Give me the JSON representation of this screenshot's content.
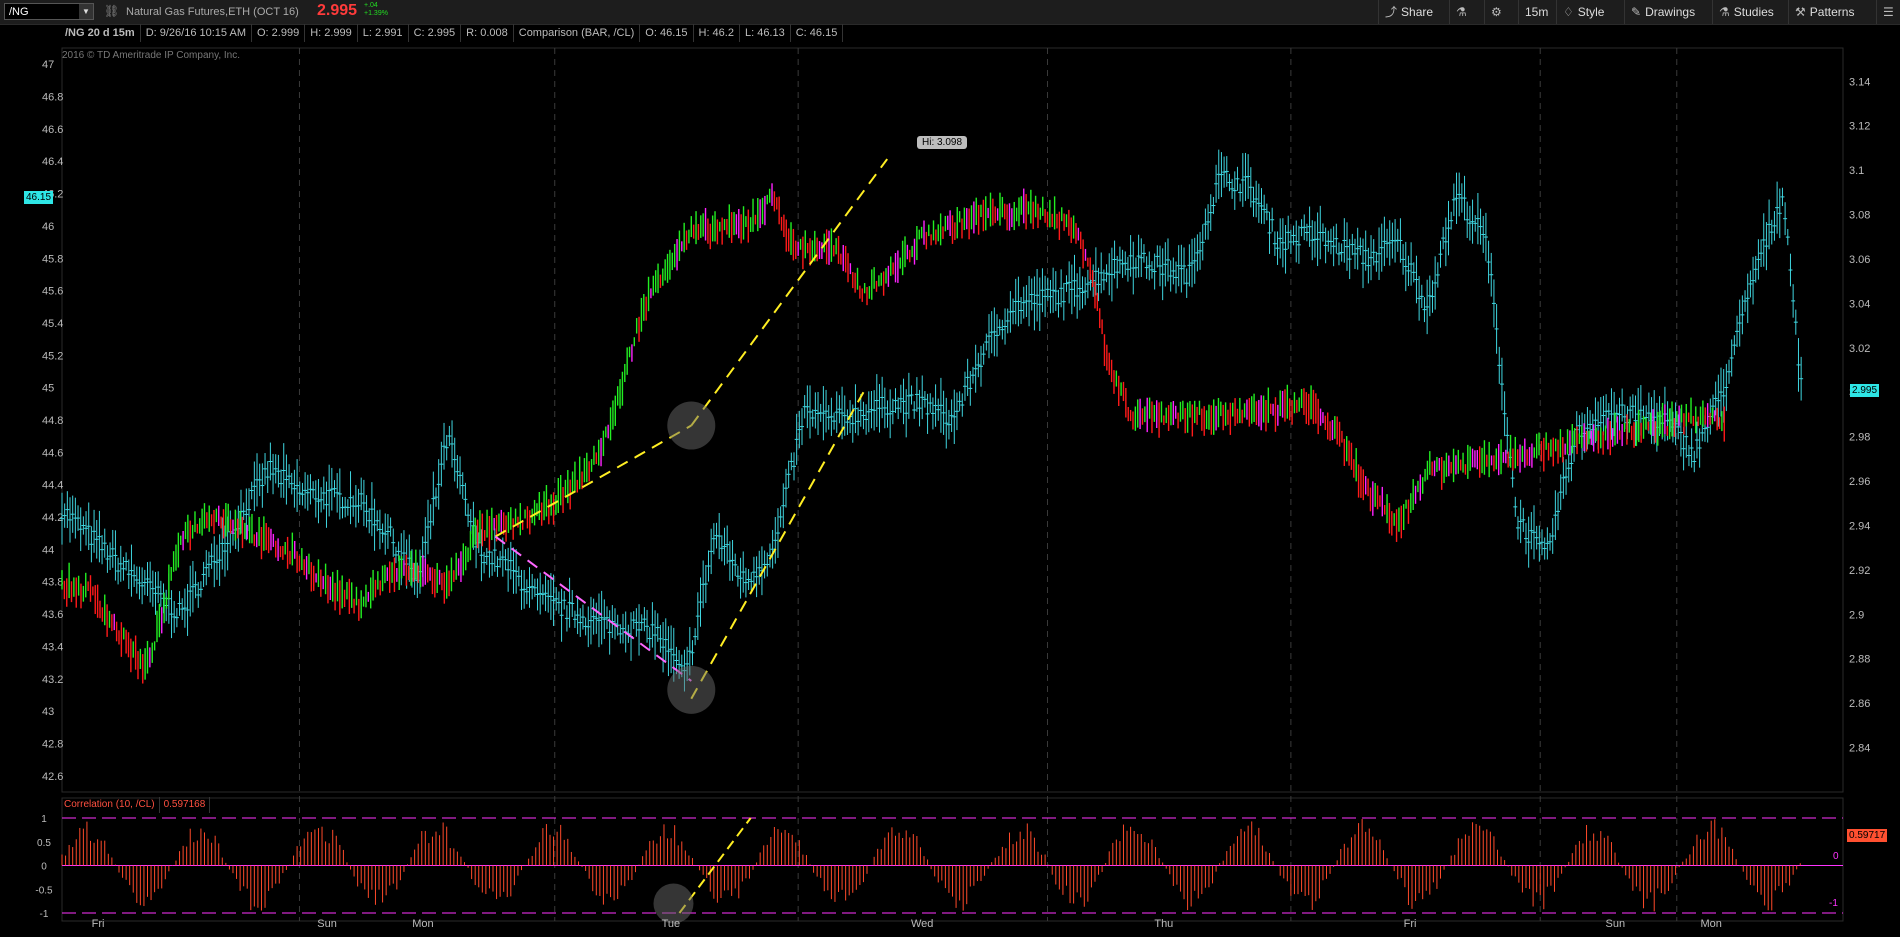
{
  "toolbar": {
    "symbol": "/NG",
    "description": "Natural Gas Futures,ETH (OCT 16)",
    "last_price": "2.995",
    "net_change": "+.04",
    "pct_change": "+1.39%",
    "timeframe": "15m",
    "share_label": "Share",
    "style_label": "Style",
    "drawings_label": "Drawings",
    "studies_label": "Studies",
    "patterns_label": "Patterns"
  },
  "infobar": {
    "symbol_period": "/NG 20 d 15m",
    "date": "D: 9/26/16 10:15 AM",
    "open": "O: 2.999",
    "high": "H: 2.999",
    "low": "L: 2.991",
    "close": "C: 2.995",
    "range": "R: 0.008",
    "comparison": "Comparison (BAR, /CL)",
    "cmp_open": "O: 46.15",
    "cmp_high": "H: 46.2",
    "cmp_low": "L: 46.13",
    "cmp_close": "C: 46.15"
  },
  "copyright": "2016 © TD Ameritrade IP Company, Inc.",
  "correlation": {
    "label": "Correlation (10, /CL)",
    "value": "0.597168",
    "badge": "0.59717",
    "right_zero": "0",
    "right_minus": "-1"
  },
  "hi_label": "Hi: 3.098",
  "left_badge": "46.15",
  "right_badge": "2.995",
  "colors": {
    "up": "#22ee22",
    "down": "#ff1a1a",
    "neutral": "#ff22ff",
    "comparison": "#3fd6e0",
    "trend": "#ffee22",
    "trend_down": "#ff66ff",
    "hist": "#ff4a2a"
  },
  "chart_data": {
    "type": "line",
    "title": "/NG 20 d 15m",
    "x_day_labels": [
      "Fri",
      "Sun",
      "Mon",
      "Tue",
      "Wed",
      "Thu",
      "Fri",
      "Sun",
      "Mon"
    ],
    "left_axis": {
      "series": "/CL comparison",
      "ylim": [
        42.5,
        47.1
      ],
      "ticks": [
        "42.6",
        "42.8",
        "43",
        "43.2",
        "43.4",
        "43.6",
        "43.8",
        "44",
        "44.2",
        "44.4",
        "44.6",
        "44.8",
        "45",
        "45.2",
        "45.4",
        "45.6",
        "45.8",
        "46",
        "46.2",
        "46.4",
        "46.6",
        "46.8",
        "47"
      ]
    },
    "right_axis": {
      "series": "/NG",
      "ylim": [
        2.82,
        3.155
      ],
      "ticks": [
        "2.84",
        "2.86",
        "2.88",
        "2.9",
        "2.92",
        "2.94",
        "2.96",
        "2.98",
        "3",
        "3.02",
        "3.04",
        "3.06",
        "3.08",
        "3.1",
        "3.12",
        "3.14"
      ]
    },
    "series": [
      {
        "name": "/NG",
        "points": [
          [
            0,
            2.913
          ],
          [
            0.5,
            2.91
          ],
          [
            1,
            2.89
          ],
          [
            1.4,
            2.875
          ],
          [
            1.7,
            2.9
          ],
          [
            2,
            2.935
          ],
          [
            2.5,
            2.945
          ],
          [
            3,
            2.94
          ],
          [
            3.5,
            2.932
          ],
          [
            4,
            2.925
          ],
          [
            4.5,
            2.912
          ],
          [
            5,
            2.905
          ],
          [
            5.5,
            2.918
          ],
          [
            6,
            2.92
          ],
          [
            6.5,
            2.913
          ],
          [
            7,
            2.937
          ],
          [
            7.5,
            2.94
          ],
          [
            8,
            2.945
          ],
          [
            8.5,
            2.955
          ],
          [
            9,
            2.97
          ],
          [
            9.3,
            2.99
          ],
          [
            9.7,
            3.03
          ],
          [
            10,
            3.05
          ],
          [
            10.6,
            3.072
          ],
          [
            11.5,
            3.075
          ],
          [
            12,
            3.088
          ],
          [
            12.3,
            3.065
          ],
          [
            13,
            3.065
          ],
          [
            13.5,
            3.045
          ],
          [
            14,
            3.055
          ],
          [
            14.5,
            3.07
          ],
          [
            15.5,
            3.08
          ],
          [
            16.5,
            3.082
          ],
          [
            17,
            3.075
          ],
          [
            17.3,
            3.06
          ],
          [
            17.6,
            3.015
          ],
          [
            18,
            2.99
          ],
          [
            18.5,
            2.99
          ],
          [
            19,
            2.99
          ],
          [
            20,
            2.99
          ],
          [
            21,
            2.995
          ],
          [
            21.5,
            2.98
          ],
          [
            22,
            2.955
          ],
          [
            22.5,
            2.94
          ],
          [
            23,
            2.965
          ],
          [
            24,
            2.97
          ],
          [
            25,
            2.975
          ],
          [
            26,
            2.98
          ],
          [
            27,
            2.985
          ],
          [
            27.5,
            2.99
          ],
          [
            28,
            2.985
          ]
        ]
      },
      {
        "name": "/CL",
        "points": [
          [
            0,
            44.25
          ],
          [
            1,
            43.9
          ],
          [
            2,
            43.6
          ],
          [
            3,
            44.2
          ],
          [
            3.5,
            44.5
          ],
          [
            4,
            44.35
          ],
          [
            5,
            44.3
          ],
          [
            5.5,
            44.1
          ],
          [
            6,
            43.8
          ],
          [
            6.5,
            44.7
          ],
          [
            7,
            44.0
          ],
          [
            7.5,
            43.9
          ],
          [
            8,
            43.7
          ],
          [
            9,
            43.55
          ],
          [
            10,
            43.5
          ],
          [
            10.5,
            43.2
          ],
          [
            11,
            44.1
          ],
          [
            11.5,
            43.8
          ],
          [
            12,
            44.0
          ],
          [
            12.5,
            44.85
          ],
          [
            13,
            44.8
          ],
          [
            14,
            44.9
          ],
          [
            14.5,
            44.9
          ],
          [
            15,
            44.8
          ],
          [
            15.5,
            45.2
          ],
          [
            16,
            45.5
          ],
          [
            17,
            45.6
          ],
          [
            18,
            45.8
          ],
          [
            19,
            45.7
          ],
          [
            19.5,
            46.3
          ],
          [
            20,
            46.25
          ],
          [
            20.5,
            45.9
          ],
          [
            21,
            45.95
          ],
          [
            22,
            45.8
          ],
          [
            22.5,
            45.9
          ],
          [
            23,
            45.5
          ],
          [
            23.5,
            46.2
          ],
          [
            24,
            45.9
          ],
          [
            24.5,
            44.2
          ],
          [
            25,
            43.95
          ],
          [
            25.5,
            44.7
          ],
          [
            26,
            44.85
          ],
          [
            27,
            44.8
          ],
          [
            27.5,
            44.6
          ],
          [
            28,
            45.0
          ],
          [
            28.5,
            45.7
          ],
          [
            29,
            46.2
          ],
          [
            29.3,
            45.0
          ]
        ]
      }
    ],
    "correlation_ylim": [
      -1,
      1
    ],
    "correlation_ticks": [
      "1",
      "0.5",
      "0",
      "-0.5",
      "-1"
    ]
  }
}
